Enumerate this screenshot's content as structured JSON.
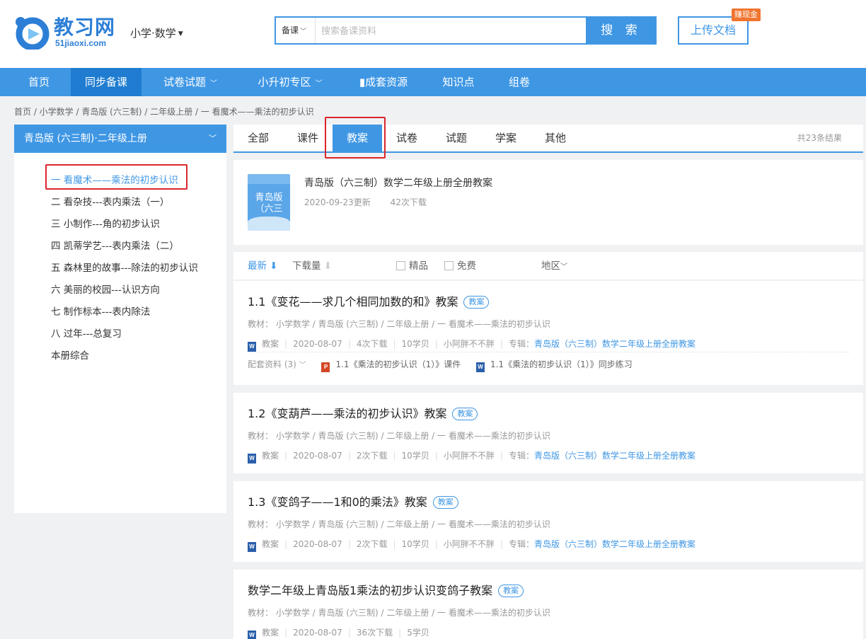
{
  "header": {
    "logo_text": "教习网",
    "logo_domain": "51jiaoxi.com",
    "grade": "小学·数学",
    "search": {
      "type": "备课",
      "placeholder": "搜索备课资料",
      "button": "搜 索"
    },
    "upload": "上传文档",
    "earn_badge": "赚现金"
  },
  "nav": [
    {
      "label": "首页"
    },
    {
      "label": "同步备课",
      "active": true
    },
    {
      "label": "试卷试题"
    },
    {
      "label": "小升初专区"
    },
    {
      "label": "▮成套资源"
    },
    {
      "label": "知识点"
    },
    {
      "label": "组卷"
    }
  ],
  "breadcrumb": "首页 /  小学数学 / 青岛版 (六三制) / 二年级上册 / 一 看魔术——乘法的初步认识",
  "sidebar": {
    "title": "青岛版 (六三制)·二年级上册",
    "chapters": [
      "一 看魔术——乘法的初步认识",
      "二 看杂技---表内乘法（一）",
      "三 小制作---角的初步认识",
      "四 凯蒂学艺---表内乘法（二）",
      "五 森林里的故事---除法的初步认识",
      "六 美丽的校园---认识方向",
      "七 制作标本---表内除法",
      "八 过年---总复习",
      "本册综合"
    ]
  },
  "tabs": [
    "全部",
    "课件",
    "教案",
    "试卷",
    "试题",
    "学案",
    "其他"
  ],
  "result_count": "共23条结果",
  "album": {
    "cover_label": "青岛版（六三",
    "title": "青岛版（六三制）数学二年级上册全册教案",
    "updated": "2020-09-23更新",
    "downloads": "42次下载"
  },
  "filters": {
    "latest": "最新",
    "downloads": "下载量",
    "premium": "精品",
    "free": "免费",
    "region": "地区"
  },
  "results": [
    {
      "title": "1.1《变花——求几个相同加数的和》教案",
      "tag": "教案",
      "path": "教材： 小学数学 / 青岛版 (六三制) / 二年级上册 / 一 看魔术——乘法的初步认识",
      "type": "教案",
      "date": "2020-08-07",
      "downloads": "4次下载",
      "points": "10学贝",
      "author": "小阿胖不不胖",
      "album_prefix": "专辑：",
      "album": "青岛版（六三制）数学二年级上册全册教案",
      "related_label": "配套资料 (3)",
      "related": [
        "1.1《乘法的初步认识（1）》课件",
        "1.1《乘法的初步认识（1）》同步练习"
      ]
    },
    {
      "title": "1.2《变葫芦——乘法的初步认识》教案",
      "tag": "教案",
      "path": "教材： 小学数学 / 青岛版 (六三制) / 二年级上册 / 一 看魔术——乘法的初步认识",
      "type": "教案",
      "date": "2020-08-07",
      "downloads": "2次下载",
      "points": "10学贝",
      "author": "小阿胖不不胖",
      "album_prefix": "专辑：",
      "album": "青岛版（六三制）数学二年级上册全册教案"
    },
    {
      "title": "1.3《变鸽子——1和0的乘法》教案",
      "tag": "教案",
      "path": "教材： 小学数学 / 青岛版 (六三制) / 二年级上册 / 一 看魔术——乘法的初步认识",
      "type": "教案",
      "date": "2020-08-07",
      "downloads": "2次下载",
      "points": "10学贝",
      "author": "小阿胖不不胖",
      "album_prefix": "专辑：",
      "album": "青岛版（六三制）数学二年级上册全册教案"
    },
    {
      "title": "数学二年级上青岛版1乘法的初步认识变鸽子教案",
      "tag": "教案",
      "path": "教材： 小学数学 / 青岛版 (六三制) / 二年级上册 / 一 看魔术——乘法的初步认识",
      "type": "教案",
      "date": "2020-08-07",
      "downloads": "36次下载",
      "points": "5学贝"
    }
  ],
  "colors": {
    "primary": "#3f97e4",
    "nav_active": "#1f7cd0",
    "highlight_box": "#d9262c",
    "badge": "#f0742e"
  }
}
